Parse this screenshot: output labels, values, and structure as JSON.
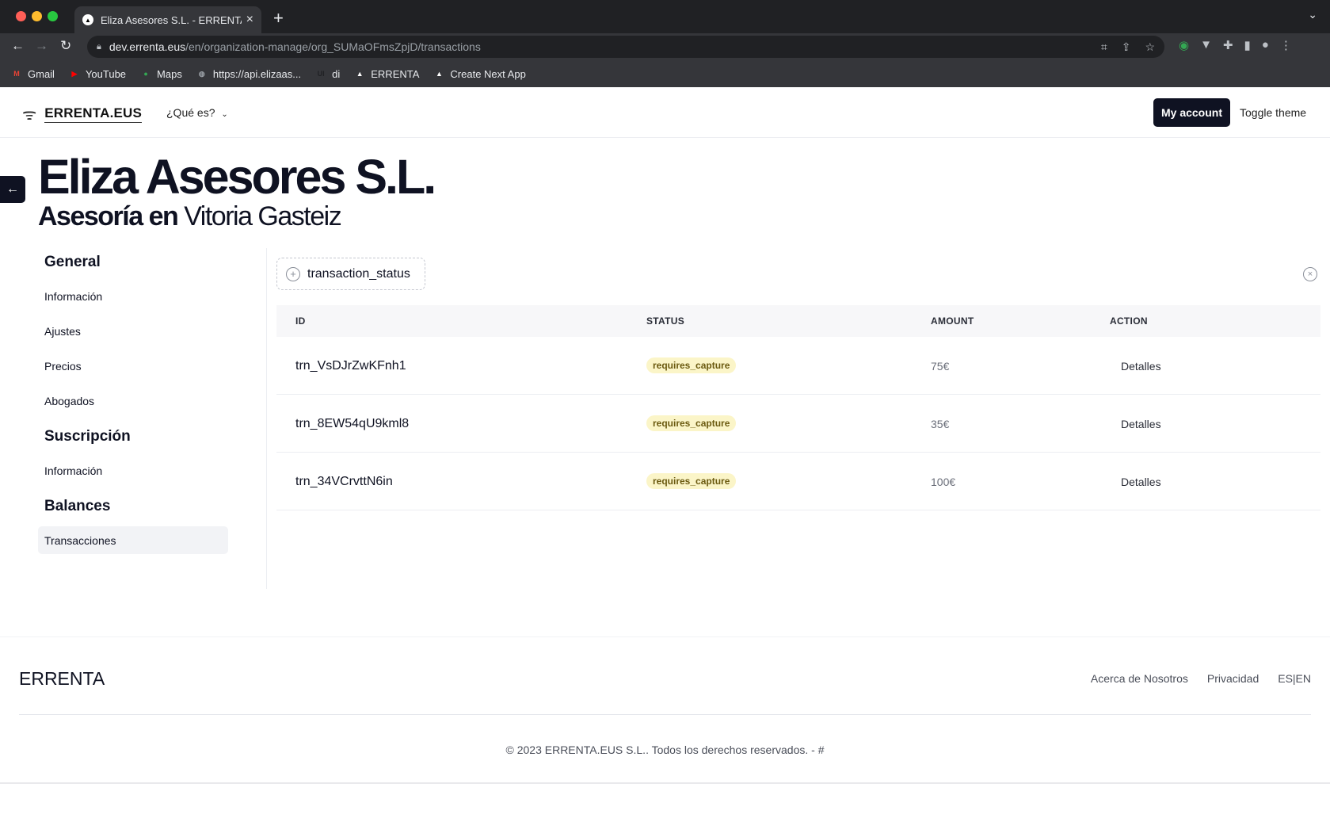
{
  "browser": {
    "tab_title": "Eliza Asesores S.L. - ERRENTA",
    "tab_favicon": "▲",
    "url_host": "dev.errenta.eus",
    "url_path": "/en/organization-manage/org_SUMaOFmsZpjD/transactions",
    "bookmarks": [
      {
        "label": "Gmail",
        "icon": "gmail-icon",
        "glyph": "M",
        "color": "#ea4335"
      },
      {
        "label": "YouTube",
        "icon": "youtube-icon",
        "glyph": "▶",
        "color": "#ff0000"
      },
      {
        "label": "Maps",
        "icon": "maps-icon",
        "glyph": "●",
        "color": "#34a853"
      },
      {
        "label": "https://api.elizaas...",
        "icon": "globe-icon",
        "glyph": "◍",
        "color": "#9aa0a6"
      },
      {
        "label": "di",
        "icon": "ui-icon",
        "glyph": "UI",
        "color": "#202124"
      },
      {
        "label": "ERRENTA",
        "icon": "triangle-icon",
        "glyph": "▲",
        "color": "#ffffff"
      },
      {
        "label": "Create Next App",
        "icon": "triangle-icon",
        "glyph": "▲",
        "color": "#ffffff"
      }
    ]
  },
  "header": {
    "logo_text": "ERRENTA.EUS",
    "nav_label": "¿Qué es?",
    "my_account_label": "My account",
    "toggle_theme_label": "Toggle theme"
  },
  "org": {
    "name": "Eliza Asesores S.L.",
    "subtitle_bold": "Asesoría en",
    "subtitle_light": "Vitoria Gasteiz"
  },
  "sidebar": {
    "sections": [
      {
        "heading": "General",
        "items": [
          "Información",
          "Ajustes",
          "Precios",
          "Abogados"
        ]
      },
      {
        "heading": "Suscripción",
        "items": [
          "Información"
        ]
      },
      {
        "heading": "Balances",
        "items": [
          "Transacciones"
        ]
      }
    ],
    "active_item": "Transacciones"
  },
  "filter": {
    "label": "transaction_status"
  },
  "table": {
    "columns": [
      "ID",
      "STATUS",
      "AMOUNT",
      "ACTION"
    ],
    "rows": [
      {
        "id": "trn_VsDJrZwKFnh1",
        "status": "requires_capture",
        "amount": "75€",
        "action": "Detalles"
      },
      {
        "id": "trn_8EW54qU9kml8",
        "status": "requires_capture",
        "amount": "35€",
        "action": "Detalles"
      },
      {
        "id": "trn_34VCrvttN6in",
        "status": "requires_capture",
        "amount": "100€",
        "action": "Detalles"
      }
    ]
  },
  "footer": {
    "brand": "ERRENTA",
    "links": [
      "Acerca de Nosotros",
      "Privacidad",
      "ES|EN"
    ],
    "copyright": "© 2023 ERRENTA.EUS S.L.. Todos los derechos reservados. - #"
  }
}
